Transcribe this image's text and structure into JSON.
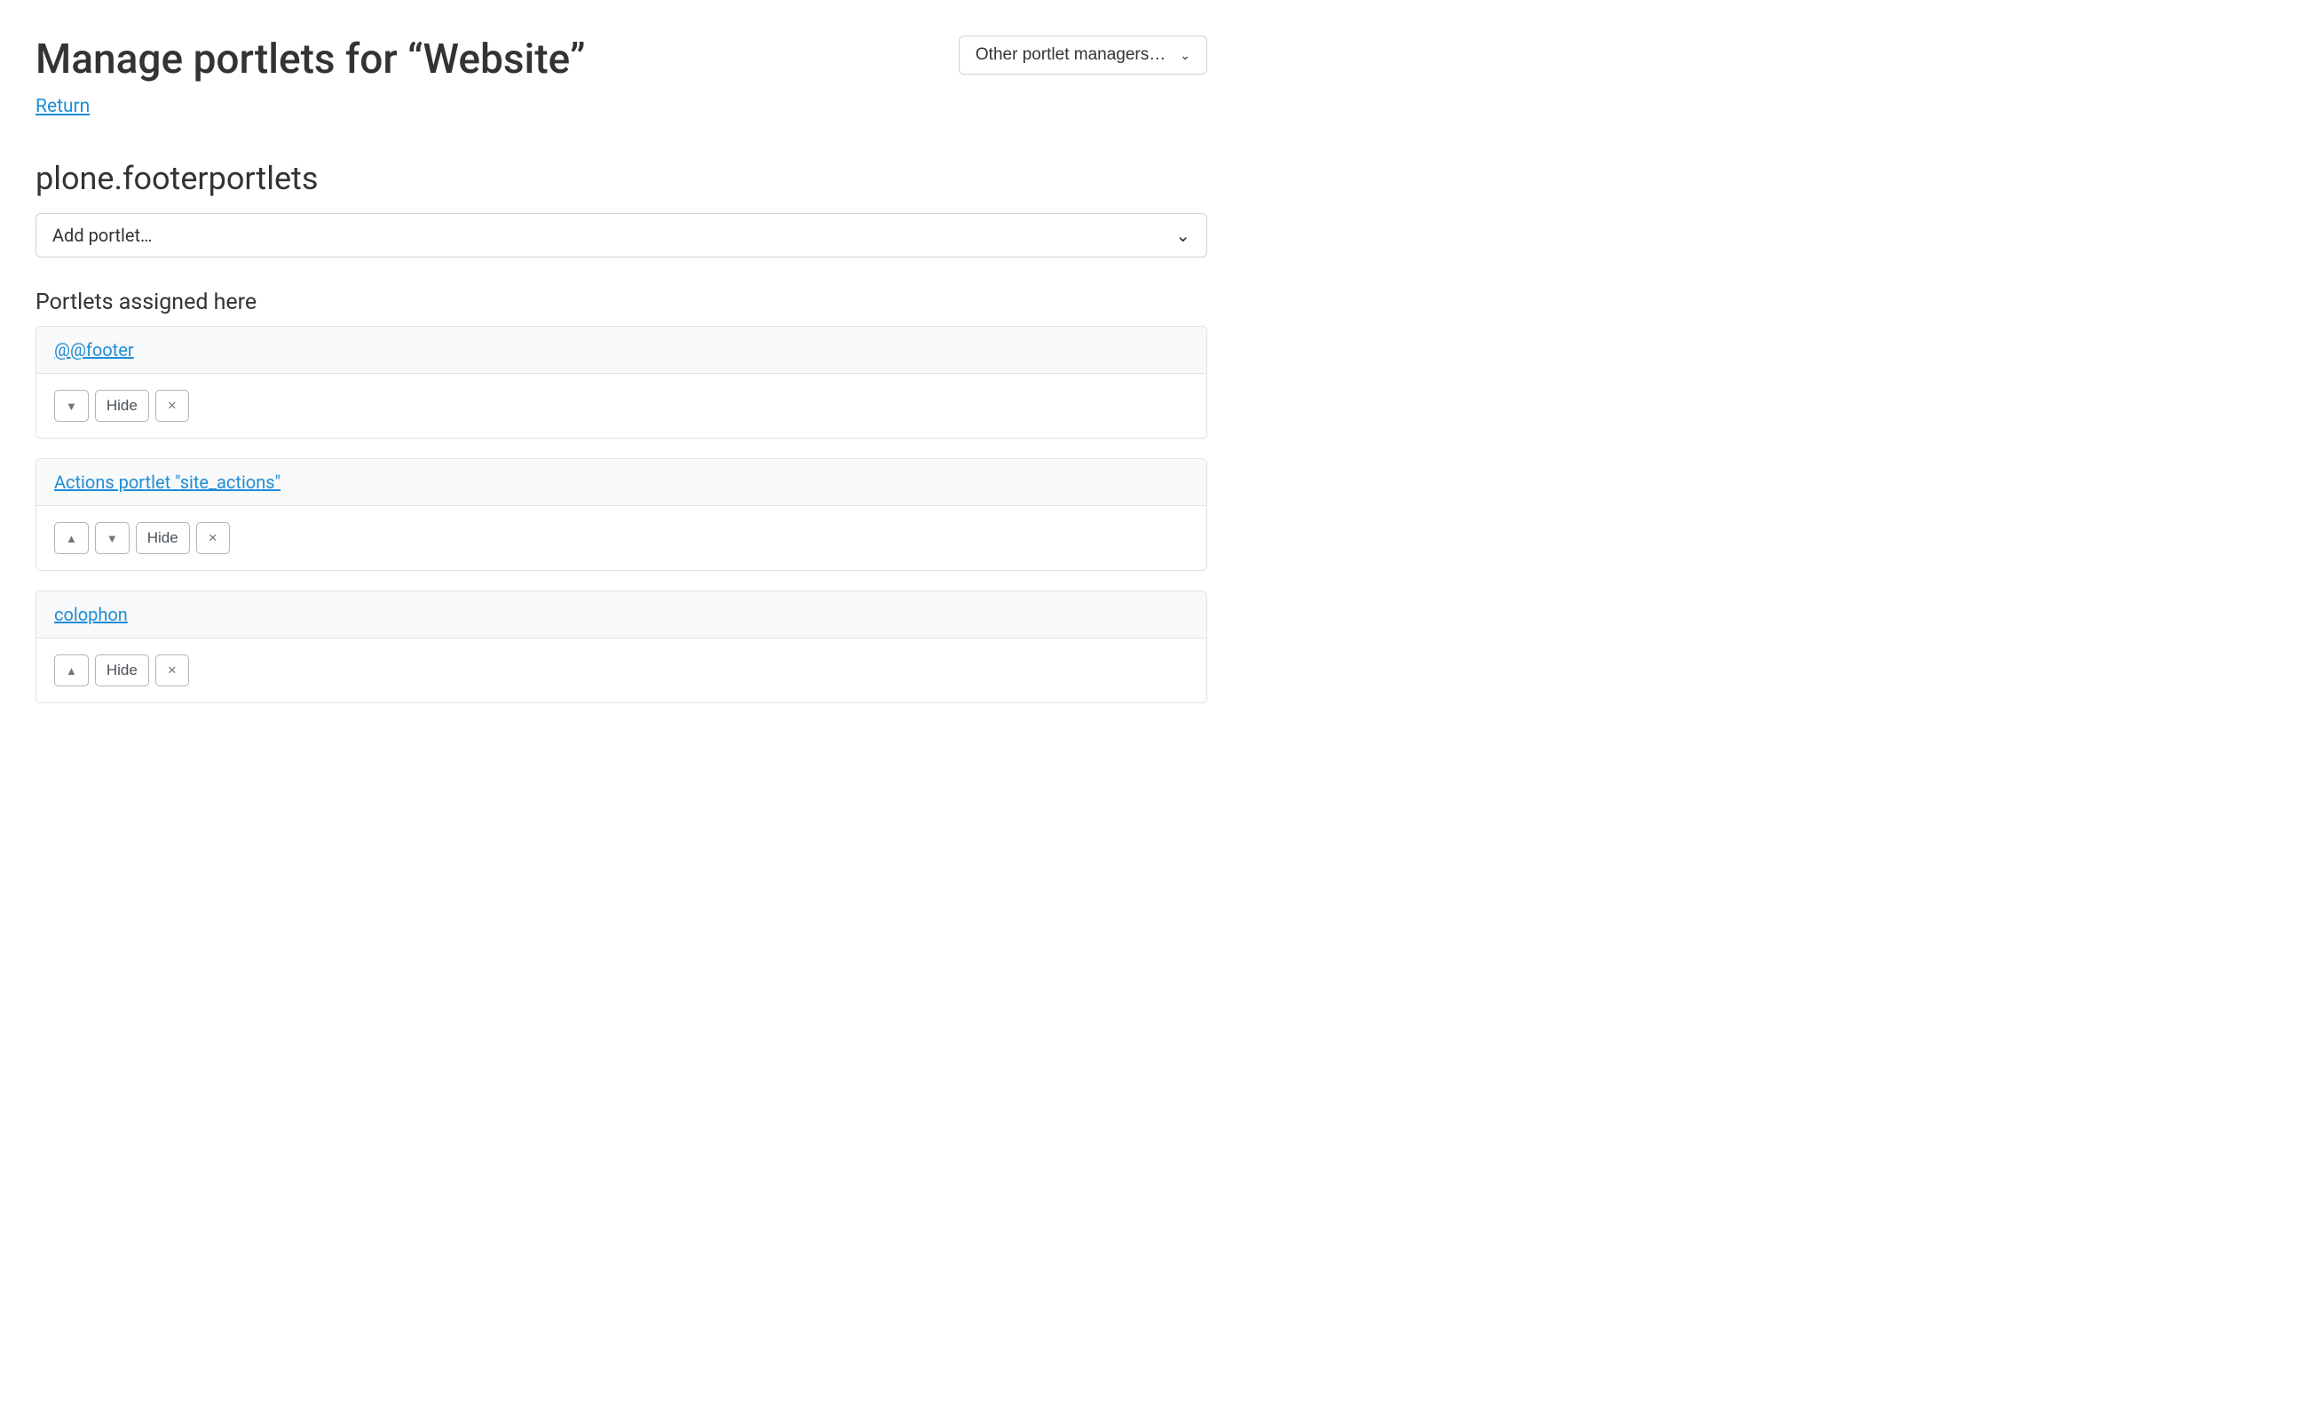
{
  "header": {
    "title": "Manage portlets for “Website”",
    "other_managers_label": "Other portlet managers…",
    "return_label": "Return"
  },
  "section": {
    "title": "plone.footerportlets",
    "add_label": "Add portlet…",
    "assigned_label": "Portlets assigned here"
  },
  "buttons": {
    "hide": "Hide",
    "close": "×",
    "up": "▲",
    "down": "▼",
    "chev": "⌄"
  },
  "portlets": [
    {
      "name": "@@footer",
      "up": false,
      "down": true
    },
    {
      "name": "Actions portlet \"site_actions\"",
      "up": true,
      "down": true
    },
    {
      "name": "colophon",
      "up": true,
      "down": false
    }
  ]
}
